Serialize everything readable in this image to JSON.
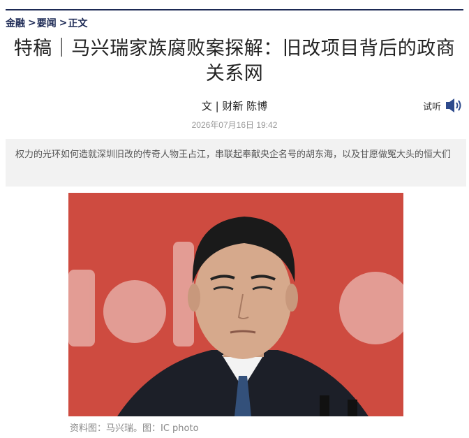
{
  "breadcrumb": [
    {
      "label": "金融"
    },
    {
      "sep": ">",
      "label": "要闻"
    },
    {
      "sep": ">",
      "label": "正文"
    }
  ],
  "article": {
    "title_line1": "特稿｜马兴瑞家族腐败案探解：旧改项目背后的政商",
    "title_line2": "关系网",
    "byline": "文 | 财新 陈博",
    "listen_label": "试听",
    "date": "2026年07月16日 19:42",
    "summary": "权力的光环如何造就深圳旧改的传奇人物王占江，串联起奉献央企名号的胡东海，以及甘愿做冤大头的恒大们",
    "photo_caption": "资料图：马兴瑞。图：IC photo"
  },
  "icons": {
    "listen": "speaker-icon"
  },
  "colors": {
    "nav": "#1d2a55",
    "photo_background": "#c9443a",
    "speaker": "#2d4a8c"
  }
}
